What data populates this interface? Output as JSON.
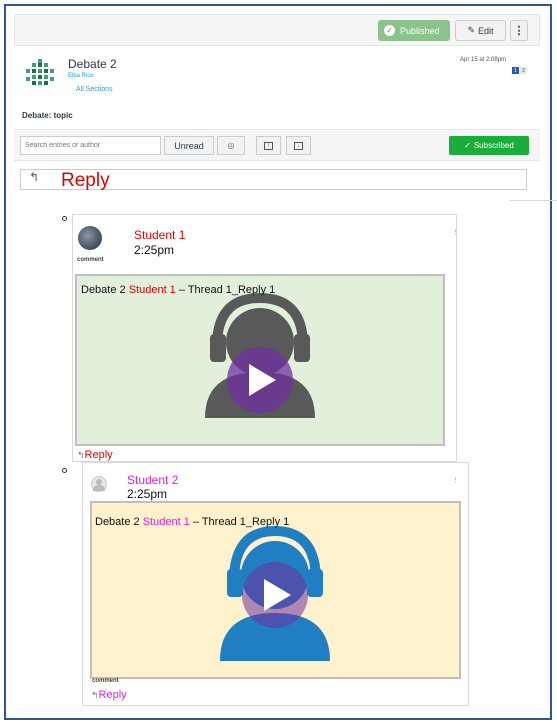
{
  "header": {
    "published_label": "Published",
    "edit_label": "Edit",
    "more_label": "⋮"
  },
  "post": {
    "title": "Debate 2",
    "author": "Elba Rios",
    "sections": "All Sections",
    "date": "Apr 15 at 2:08pm",
    "unread_count": "1",
    "total_count": "2",
    "topic": "Debate: topic"
  },
  "toolbar": {
    "search_placeholder": "Search entries or author",
    "unread_label": "Unread",
    "subscribed_label": "Subscribed"
  },
  "reply_bar": {
    "label": "Reply"
  },
  "entries": [
    {
      "author": "Student 1",
      "time": "2:25pm",
      "tag": "comment",
      "caption_prefix": "Debate 2 ",
      "caption_name": "Student 1",
      "caption_suffix": " – Thread 1_Reply 1",
      "reply_label": "Reply",
      "colors": {
        "name": "#e00000",
        "video_bg": "#e2efda"
      }
    },
    {
      "author": "Student 2",
      "time": "2:25pm",
      "tag": "comment",
      "caption_prefix": "Debate 2 ",
      "caption_name": "Student 1",
      "caption_suffix": " – Thread 1_Reply 1",
      "reply_label": "Reply",
      "colors": {
        "name": "#e020e0",
        "video_bg": "#fff2cc"
      }
    }
  ],
  "icons": {
    "published": "check-circle-icon",
    "edit": "pencil-icon",
    "reply": "reply-arrow-icon",
    "view": "eye-icon",
    "collapse": "collapse-icon",
    "expand": "expand-icon",
    "subscribed": "checkmark-icon",
    "play": "play-icon"
  },
  "colors": {
    "frame_border": "#2f5597",
    "published_green": "#8cc38c",
    "subscribed_green": "#1bad3a",
    "link_blue": "#2d9cdb"
  }
}
